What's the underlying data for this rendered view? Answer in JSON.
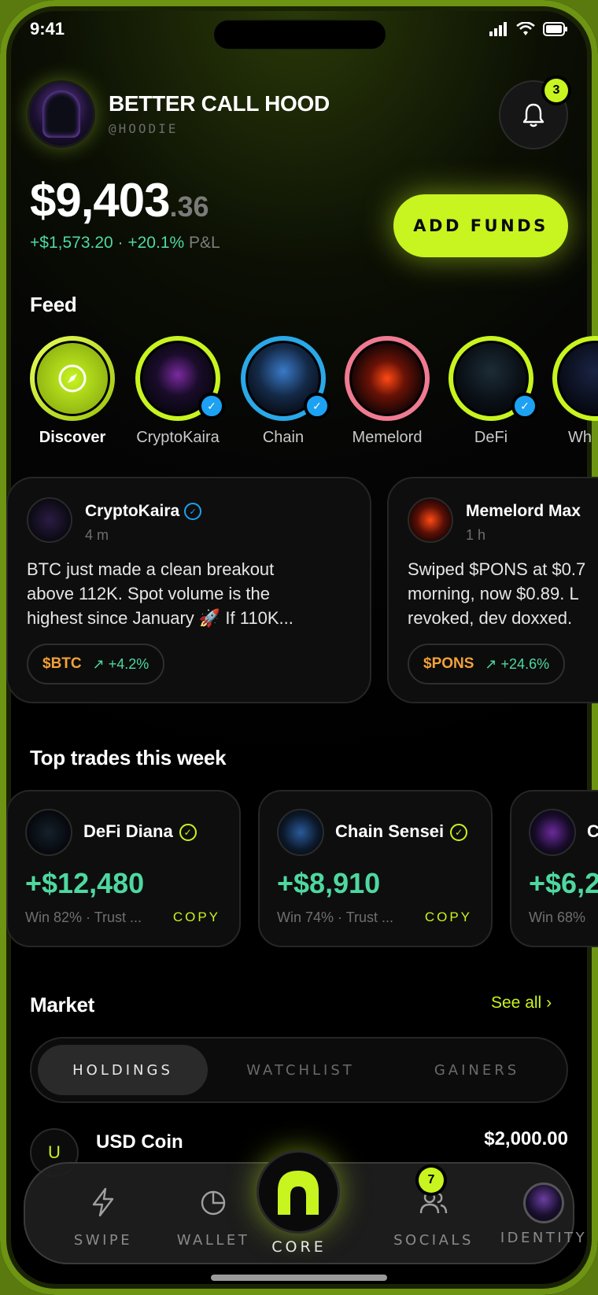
{
  "status_bar": {
    "time": "9:41"
  },
  "header": {
    "name": "BETTER CALL HOOD",
    "handle": "@HOODIE",
    "notifications_count": "3"
  },
  "balance": {
    "main": "$9,403",
    "cents": ".36",
    "pnl_amount": "+$1,573.20",
    "pnl_sep": " · ",
    "pnl_percent": "+20.1%",
    "pnl_label": " P&L",
    "add_funds_label": "ADD FUNDS"
  },
  "feed": {
    "title": "Feed",
    "stories": [
      {
        "label": "Discover"
      },
      {
        "label": "CryptoKaira"
      },
      {
        "label": "Chain"
      },
      {
        "label": "Memelord"
      },
      {
        "label": "DeFi"
      },
      {
        "label": "Wh"
      }
    ],
    "posts": [
      {
        "name": "CryptoKaira",
        "time": "4 m",
        "text": "BTC just made a clean breakout\nabove 112K. Spot volume is the\nhighest since January 🚀  If 110K...",
        "ticker": "$BTC",
        "change": "+4.2%"
      },
      {
        "name": "Memelord Max",
        "time": "1 h",
        "text": "Swiped $PONS at $0.7\nmorning, now $0.89. L\nrevoked, dev doxxed.",
        "ticker": "$PONS",
        "change": "+24.6%"
      }
    ]
  },
  "top_trades": {
    "title": "Top trades this week",
    "cards": [
      {
        "name": "DeFi Diana",
        "amount": "+$12,480",
        "meta": "Win 82% · Trust ...",
        "action": "COPY"
      },
      {
        "name": "Chain Sensei",
        "amount": "+$8,910",
        "meta": "Win 74% · Trust ...",
        "action": "COPY"
      },
      {
        "name": "C",
        "amount": "+$6,2",
        "meta": "Win 68%",
        "action": ""
      }
    ]
  },
  "market": {
    "title": "Market",
    "see_all": "See all",
    "tabs": [
      "HOLDINGS",
      "WATCHLIST",
      "GAINERS"
    ],
    "active_tab": "HOLDINGS",
    "holdings": [
      {
        "symbol_letter": "U",
        "name": "USD Coin",
        "value": "$2,000.00"
      }
    ]
  },
  "bottom_nav": {
    "items": [
      "SWIPE",
      "WALLET",
      "CORE",
      "SOCIALS",
      "IDENTITY"
    ],
    "socials_badge": "7"
  },
  "colors": {
    "accent": "#c8f41f",
    "positive": "#4ed8a0",
    "ticker": "#f2a23a",
    "verified": "#1da1f2"
  }
}
